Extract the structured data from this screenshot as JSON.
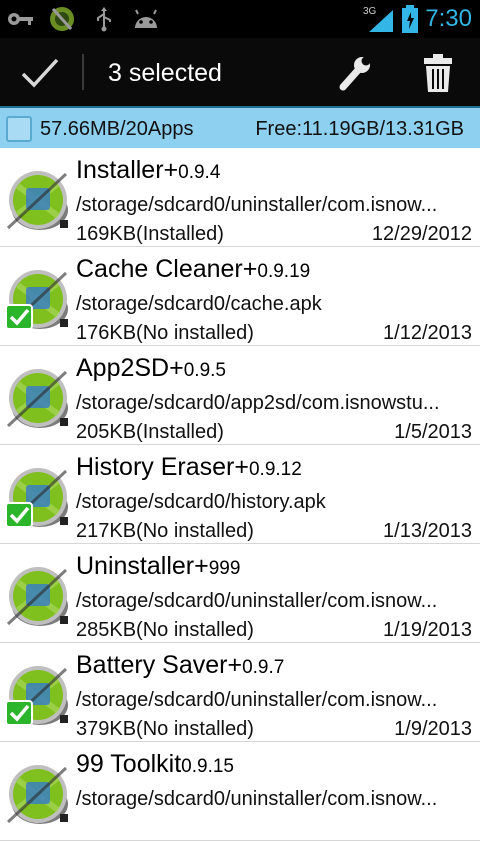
{
  "status_bar": {
    "network": "3G",
    "time": "7:30",
    "icons": [
      "key-icon",
      "android-robot-icon",
      "usb-icon",
      "android-head-icon",
      "signal-icon",
      "battery-icon"
    ]
  },
  "action_bar": {
    "done_icon": "check-icon",
    "title": "3 selected",
    "tools_icon": "wrench-icon",
    "delete_icon": "trash-icon"
  },
  "summary": {
    "left": "57.66MB/20Apps",
    "right": "Free:11.19GB/13.31GB",
    "checked": true
  },
  "colors": {
    "accent": "#33b5e5",
    "summary_bg": "#8ed0f0",
    "check_green": "#2bb52b",
    "robot_green": "#7fbf1e"
  },
  "apps": [
    {
      "name": "Installer+",
      "version": "0.9.4",
      "path": "/storage/sdcard0/uninstaller/com.isnow...",
      "size": "169KB(Installed)",
      "date": "12/29/2012",
      "selected": false,
      "icon": "installer-icon"
    },
    {
      "name": "Cache Cleaner+",
      "version": "0.9.19",
      "path": "/storage/sdcard0/cache.apk",
      "size": "176KB(No installed)",
      "date": "1/12/2013",
      "selected": true,
      "icon": "cache-cleaner-icon"
    },
    {
      "name": "App2SD+",
      "version": "0.9.5",
      "path": "/storage/sdcard0/app2sd/com.isnowstu...",
      "size": "205KB(Installed)",
      "date": "1/5/2013",
      "selected": false,
      "icon": "app2sd-icon"
    },
    {
      "name": "History Eraser+",
      "version": "0.9.12",
      "path": "/storage/sdcard0/history.apk",
      "size": "217KB(No installed)",
      "date": "1/13/2013",
      "selected": true,
      "icon": "history-eraser-icon"
    },
    {
      "name": "Uninstaller+",
      "version": "999",
      "path": "/storage/sdcard0/uninstaller/com.isnow...",
      "size": "285KB(No installed)",
      "date": "1/19/2013",
      "selected": false,
      "icon": "uninstaller-icon"
    },
    {
      "name": "Battery Saver+",
      "version": "0.9.7",
      "path": "/storage/sdcard0/uninstaller/com.isnow...",
      "size": "379KB(No installed)",
      "date": "1/9/2013",
      "selected": true,
      "icon": "battery-saver-icon"
    },
    {
      "name": "99 Toolkit",
      "version": "0.9.15",
      "path": "/storage/sdcard0/uninstaller/com.isnow...",
      "size": "",
      "date": "",
      "selected": false,
      "icon": "toolkit-icon"
    }
  ]
}
